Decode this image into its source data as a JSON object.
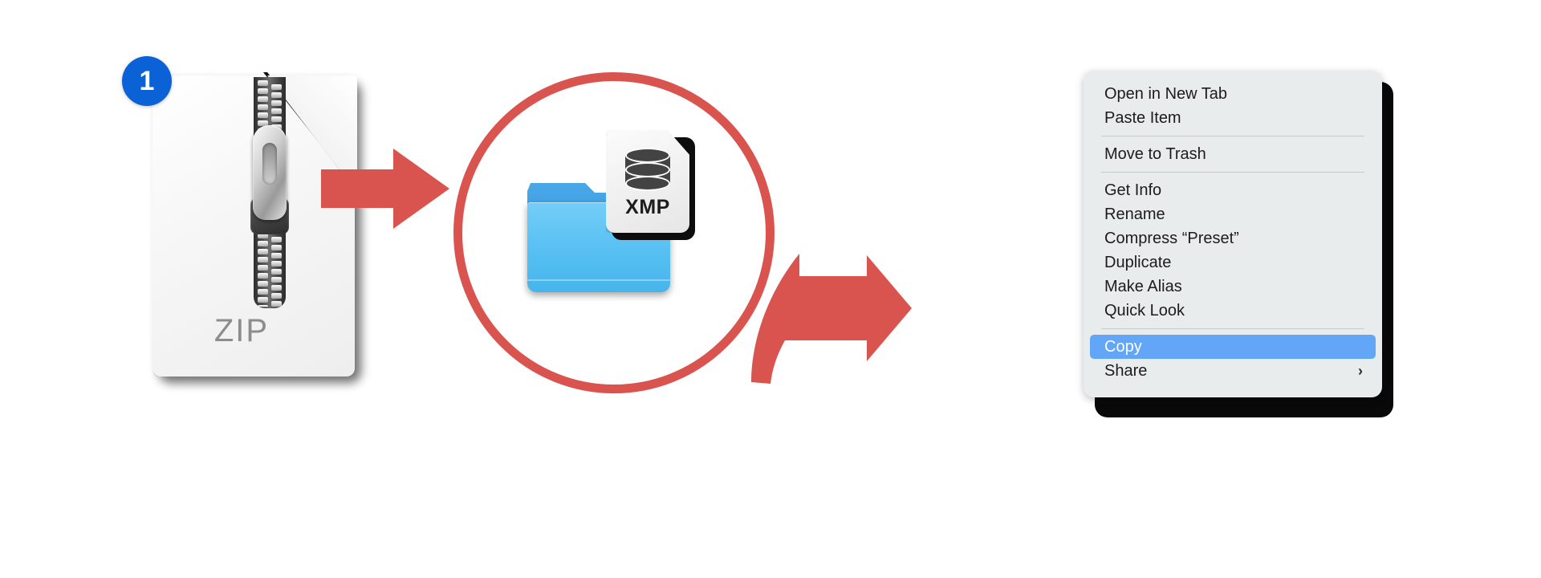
{
  "steps": {
    "zip": {
      "badge_number": "1",
      "file_type_label": "ZIP",
      "icon_name": "zip-archive-icon"
    },
    "folder": {
      "folder_icon_name": "blue-folder-icon",
      "file_type_label": "XMP",
      "file_icon_name": "xmp-database-file-icon",
      "magnifier_name": "magnifier-circle"
    }
  },
  "arrows": [
    {
      "name": "arrow-zip-to-folder",
      "direction": "right"
    },
    {
      "name": "arrow-folder-to-menu",
      "direction": "down-right"
    }
  ],
  "context_menu": {
    "groups": [
      {
        "items": [
          {
            "label": "Open in New Tab",
            "selected": false,
            "submenu": false
          },
          {
            "label": "Paste Item",
            "selected": false,
            "submenu": false
          }
        ]
      },
      {
        "items": [
          {
            "label": "Move to Trash",
            "selected": false,
            "submenu": false
          }
        ]
      },
      {
        "items": [
          {
            "label": "Get Info",
            "selected": false,
            "submenu": false
          },
          {
            "label": "Rename",
            "selected": false,
            "submenu": false
          },
          {
            "label": "Compress “Preset”",
            "selected": false,
            "submenu": false
          },
          {
            "label": "Duplicate",
            "selected": false,
            "submenu": false
          },
          {
            "label": "Make Alias",
            "selected": false,
            "submenu": false
          },
          {
            "label": "Quick Look",
            "selected": false,
            "submenu": false
          }
        ]
      },
      {
        "items": [
          {
            "label": "Copy",
            "selected": true,
            "submenu": false
          },
          {
            "label": "Share",
            "selected": false,
            "submenu": true,
            "submenu_glyph": "›"
          }
        ]
      }
    ]
  },
  "colors": {
    "accent_red": "#d9544f",
    "badge_blue": "#0b62d6",
    "selection_blue": "#63a6f7",
    "menu_background": "#e9ecec",
    "folder_blue": "#57c0f3",
    "background": "#ffffff"
  }
}
